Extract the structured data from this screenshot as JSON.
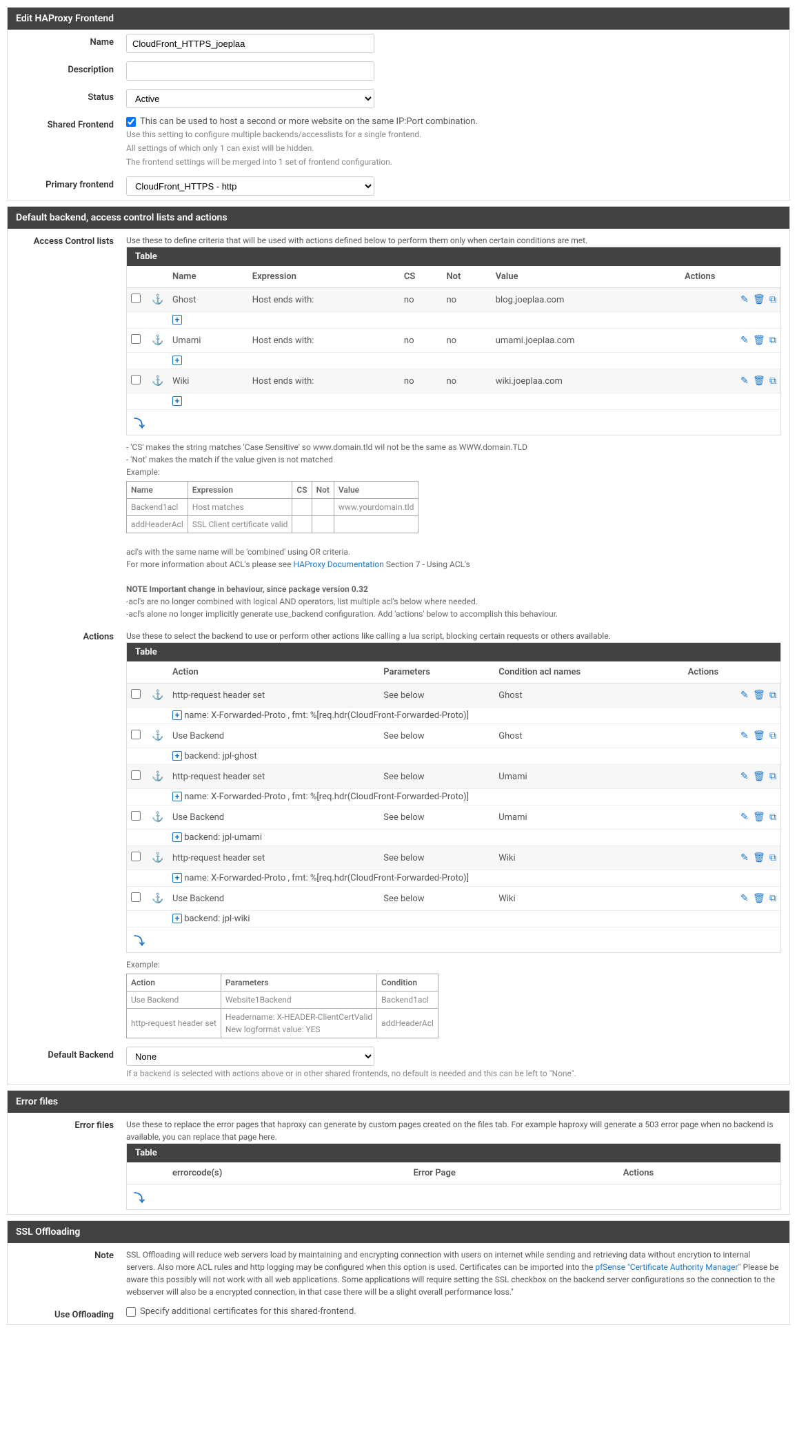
{
  "section1": {
    "title": "Edit HAProxy Frontend"
  },
  "name": {
    "label": "Name",
    "value": "CloudFront_HTTPS_joeplaa"
  },
  "description": {
    "label": "Description",
    "value": ""
  },
  "status": {
    "label": "Status",
    "value": "Active"
  },
  "shared": {
    "label": "Shared Frontend",
    "text": "This can be used to host a second or more website on the same IP:Port combination.",
    "help1": "Use this setting to configure multiple backends/accesslists for a single frontend.",
    "help2": "All settings of which only 1 can exist will be hidden.",
    "help3": "The frontend settings will be merged into 1 set of frontend configuration."
  },
  "primary": {
    "label": "Primary frontend",
    "value": "CloudFront_HTTPS - http"
  },
  "section2": {
    "title": "Default backend, access control lists and actions"
  },
  "acl": {
    "label": "Access Control lists",
    "intro": "Use these to define criteria that will be used with actions defined below to perform them only when certain conditions are met.",
    "tableTitle": "Table",
    "cols": {
      "name": "Name",
      "expr": "Expression",
      "cs": "CS",
      "not": "Not",
      "value": "Value",
      "actions": "Actions"
    },
    "rows": [
      {
        "name": "Ghost",
        "expr": "Host ends with:",
        "cs": "no",
        "not": "no",
        "value": "blog.joeplaa.com"
      },
      {
        "name": "Umami",
        "expr": "Host ends with:",
        "cs": "no",
        "not": "no",
        "value": "umami.joeplaa.com"
      },
      {
        "name": "Wiki",
        "expr": "Host ends with:",
        "cs": "no",
        "not": "no",
        "value": "wiki.joeplaa.com"
      }
    ],
    "help1": "- 'CS' makes the string matches 'Case Sensitive' so www.domain.tld wil not be the same as WWW.domain.TLD",
    "help2": "- 'Not' makes the match if the value given is not matched",
    "exampleLabel": "Example:",
    "exCols": {
      "name": "Name",
      "expr": "Expression",
      "cs": "CS",
      "not": "Not",
      "value": "Value"
    },
    "exRows": [
      {
        "name": "Backend1acl",
        "expr": "Host matches",
        "cs": "",
        "not": "",
        "value": "www.yourdomain.tld"
      },
      {
        "name": "addHeaderAcl",
        "expr": "SSL Client certificate valid",
        "cs": "",
        "not": "",
        "value": ""
      }
    ],
    "help3": "acl's with the same name will be 'combined' using OR criteria.",
    "help4a": "For more information about ACL's please see ",
    "help4link": "HAProxy Documentation",
    "help4b": " Section 7 - Using ACL's",
    "noteTitle": "NOTE Important change in behaviour, since package version 0.32",
    "note1": "-acl's are no longer combined with logical AND operators, list multiple acl's below where needed.",
    "note2": "-acl's alone no longer implicitly generate use_backend configuration. Add 'actions' below to accomplish this behaviour."
  },
  "actions": {
    "label": "Actions",
    "intro": "Use these to select the backend to use or perform other actions like calling a lua script, blocking certain requests or others available.",
    "tableTitle": "Table",
    "cols": {
      "action": "Action",
      "params": "Parameters",
      "cond": "Condition acl names",
      "actions": "Actions"
    },
    "rows": [
      {
        "action": "http-request header set",
        "params": "See below",
        "cond": "Ghost",
        "expand": "name: X-Forwarded-Proto , fmt: %[req.hdr(CloudFront-Forwarded-Proto)]"
      },
      {
        "action": "Use Backend",
        "params": "See below",
        "cond": "Ghost",
        "expand": "backend: jpl-ghost"
      },
      {
        "action": "http-request header set",
        "params": "See below",
        "cond": "Umami",
        "expand": "name: X-Forwarded-Proto , fmt: %[req.hdr(CloudFront-Forwarded-Proto)]"
      },
      {
        "action": "Use Backend",
        "params": "See below",
        "cond": "Umami",
        "expand": "backend: jpl-umami"
      },
      {
        "action": "http-request header set",
        "params": "See below",
        "cond": "Wiki",
        "expand": "name: X-Forwarded-Proto , fmt: %[req.hdr(CloudFront-Forwarded-Proto)]"
      },
      {
        "action": "Use Backend",
        "params": "See below",
        "cond": "Wiki",
        "expand": "backend: jpl-wiki"
      }
    ],
    "exampleLabel": "Example:",
    "exCols": {
      "action": "Action",
      "params": "Parameters",
      "cond": "Condition"
    },
    "exRows": [
      {
        "action": "Use Backend",
        "params": "Website1Backend",
        "cond": "Backend1acl"
      },
      {
        "action": "http-request header set",
        "params": "Headername: X-HEADER-ClientCertValid\nNew logformat value: YES",
        "cond": "addHeaderAcl"
      }
    ]
  },
  "defaultBackend": {
    "label": "Default Backend",
    "value": "None",
    "help": "If a backend is selected with actions above or in other shared frontends, no default is needed and this can be left to \"None\"."
  },
  "section3": {
    "title": "Error files"
  },
  "errorFiles": {
    "label": "Error files",
    "intro": "Use these to replace the error pages that haproxy can generate by custom pages created on the files tab. For example haproxy will generate a 503 error page when no backend is available, you can replace that page here.",
    "tableTitle": "Table",
    "cols": {
      "code": "errorcode(s)",
      "page": "Error Page",
      "actions": "Actions"
    }
  },
  "section4": {
    "title": "SSL Offloading"
  },
  "ssl": {
    "noteLabel": "Note",
    "noteA": "SSL Offloading will reduce web servers load by maintaining and encrypting connection with users on internet while sending and retrieving data without encrytion to internal servers. Also more ACL rules and http logging may be configured when this option is used. Certificates can be imported into the ",
    "noteLink": "pfSense \"Certificate Authority Manager\"",
    "noteB": " Please be aware this possibly will not work with all web applications. Some applications will require setting the SSL checkbox on the backend server configurations so the connection to the webserver will also be a encrypted connection, in that case there will be a slight overall performance loss.\"",
    "useLabel": "Use Offloading",
    "useText": "Specify additional certificates for this shared-frontend."
  }
}
